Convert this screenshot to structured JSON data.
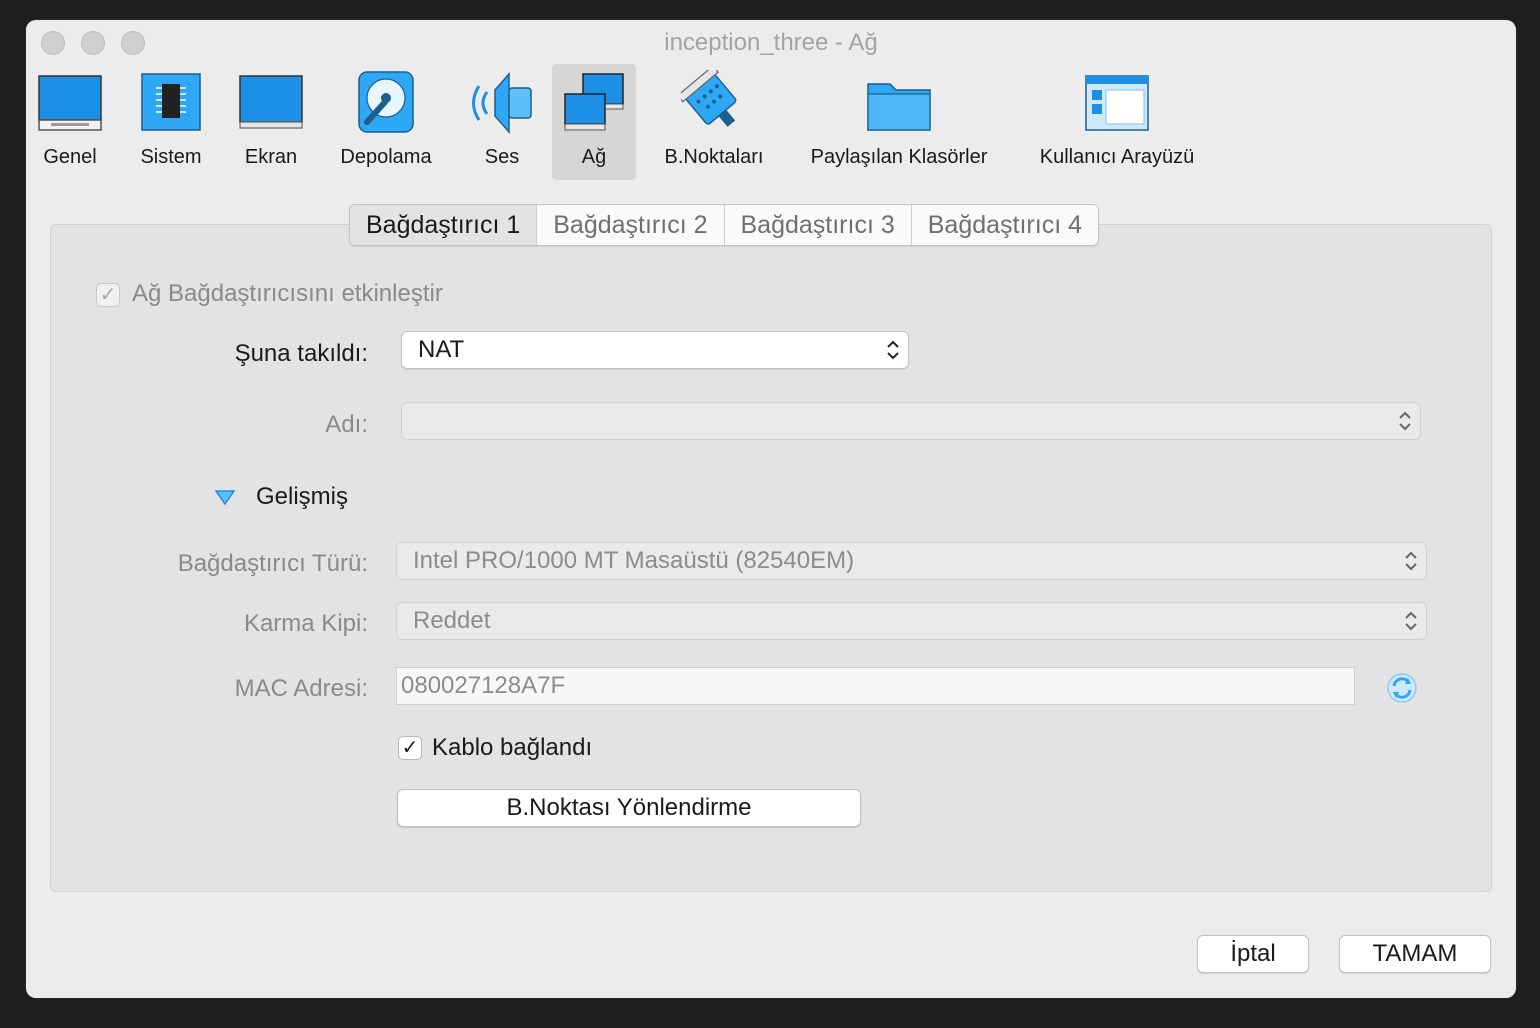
{
  "window": {
    "title": "inception_three - Ağ"
  },
  "toolbar": {
    "items": [
      {
        "label": "Genel"
      },
      {
        "label": "Sistem"
      },
      {
        "label": "Ekran"
      },
      {
        "label": "Depolama"
      },
      {
        "label": "Ses"
      },
      {
        "label": "Ağ"
      },
      {
        "label": "B.Noktaları"
      },
      {
        "label": "Paylaşılan Klasörler"
      },
      {
        "label": "Kullanıcı Arayüzü"
      }
    ],
    "selected": "Ağ"
  },
  "tabs": [
    {
      "label": "Bağdaştırıcı 1",
      "active": true
    },
    {
      "label": "Bağdaştırıcı 2"
    },
    {
      "label": "Bağdaştırıcı 3"
    },
    {
      "label": "Bağdaştırıcı 4"
    }
  ],
  "form": {
    "enable_adapter_label": "Ağ Bağdaştırıcısını etkinleştir",
    "enable_adapter_check": "✓",
    "attached_to_label": "Şuna takıldı:",
    "attached_to_value": "NAT",
    "name_label": "Adı:",
    "name_value": "",
    "advanced_label": "Gelişmiş",
    "adapter_type_label": "Bağdaştırıcı Türü:",
    "adapter_type_value": "Intel PRO/1000 MT Masaüstü (82540EM)",
    "promisc_label": "Karma Kipi:",
    "promisc_value": "Reddet",
    "mac_label": "MAC Adresi:",
    "mac_value": "080027128A7F",
    "cable_label": "Kablo bağlandı",
    "cable_check": "✓",
    "port_forwarding_label": "B.Noktası Yönlendirme"
  },
  "footer": {
    "cancel_label": "İptal",
    "ok_label": "TAMAM"
  },
  "colors": {
    "accent": "#1e8fe6",
    "icon_light": "#2ea8f4",
    "panel": "#e3e3e3"
  }
}
